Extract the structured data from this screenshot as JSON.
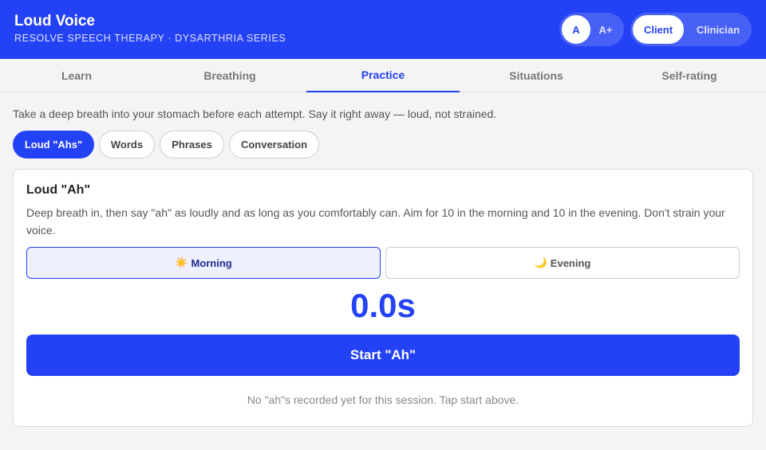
{
  "header": {
    "title": "Loud Voice",
    "subtitle": "RESOLVE SPEECH THERAPY · DYSARTHRIA SERIES",
    "font_size": {
      "normal_label": "A",
      "large_label": "A+",
      "selected": "A"
    },
    "role": {
      "client_label": "Client",
      "clinician_label": "Clinician",
      "selected": "Client"
    }
  },
  "tabs": [
    {
      "label": "Learn"
    },
    {
      "label": "Breathing"
    },
    {
      "label": "Practice"
    },
    {
      "label": "Situations"
    },
    {
      "label": "Self-rating"
    }
  ],
  "active_tab": "Practice",
  "intro": "Take a deep breath into your stomach before each attempt. Say it right away — loud, not strained.",
  "practice_modes": [
    {
      "label": "Loud \"Ahs\""
    },
    {
      "label": "Words"
    },
    {
      "label": "Phrases"
    },
    {
      "label": "Conversation"
    }
  ],
  "active_mode": "Loud \"Ahs\"",
  "exercise": {
    "title": "Loud \"Ah\"",
    "description": "Deep breath in, then say \"ah\" as loudly and as long as you comfortably can. Aim for 10 in the morning and 10 in the evening. Don't strain your voice.",
    "sessions": {
      "morning": {
        "glyph": "☀️",
        "label": "Morning"
      },
      "evening": {
        "glyph": "🌙",
        "label": "Evening"
      }
    },
    "selected_session": "Morning",
    "timer": "0.0s",
    "start_label": "Start \"Ah\"",
    "empty_note": "No \"ah\"s recorded yet for this session. Tap start above."
  },
  "colors": {
    "accent": "#2442f5",
    "background": "#f4f4f4",
    "card": "#ffffff",
    "selected_session_bg": "#eef0ff"
  },
  "icons": {
    "morning": "sun-icon",
    "evening": "moon-icon"
  }
}
